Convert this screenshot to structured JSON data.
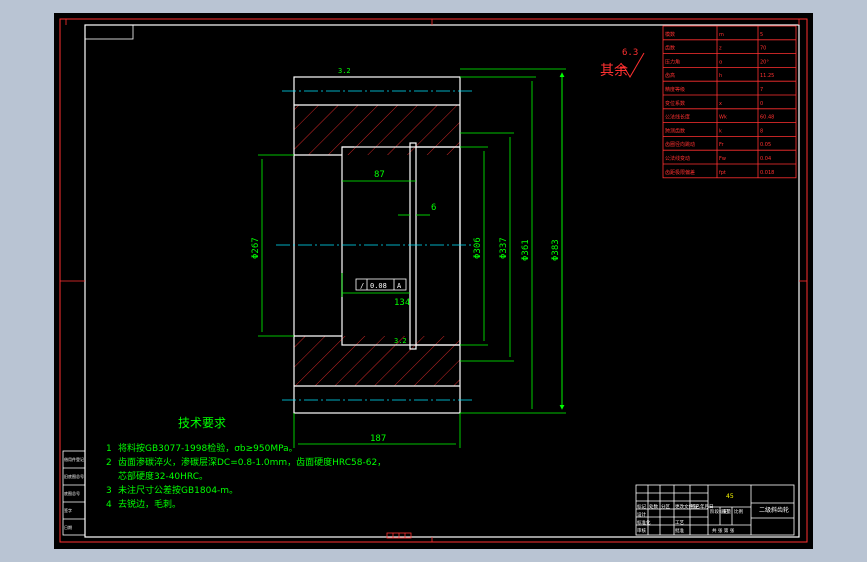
{
  "drawing": {
    "dimensions": {
      "d_large_outer": "Φ383",
      "d_outer": "Φ361",
      "d_mid": "Φ337",
      "d_inner_right": "Φ306",
      "d_bore": "Φ267",
      "len_87": "87",
      "len_134": "134",
      "len_187": "187",
      "groove_6": "6"
    },
    "roughness": {
      "top_edge": "3.2",
      "bottom_edge": "3.2",
      "rest_symbol_value": "6.3",
      "rest_label": "其余"
    },
    "tolerance_frame": {
      "symbol": "/",
      "value": "0.08",
      "datum": "A"
    },
    "tech_requirements": {
      "title": "技术要求",
      "items": [
        {
          "num": "1",
          "text": "将料按GB3077-1998检验，σb≥950MPa。"
        },
        {
          "num": "2",
          "text": "齿面渗碳淬火，渗碳层深DC=0.8-1.0mm，齿面硬度HRC58-62，"
        },
        {
          "num": "",
          "text": "芯部硬度32-40HRC。"
        },
        {
          "num": "3",
          "text": "未注尺寸公差按GB1804-m。"
        },
        {
          "num": "4",
          "text": "去锐边，毛刺。"
        }
      ]
    },
    "gear_table": [
      {
        "name": "模数",
        "sym": "m",
        "val": "5"
      },
      {
        "name": "齿数",
        "sym": "z",
        "val": "70"
      },
      {
        "name": "压力角",
        "sym": "α",
        "val": "20°"
      },
      {
        "name": "齿高",
        "sym": "h",
        "val": "11.25"
      },
      {
        "name": "精度等级",
        "sym": "",
        "val": "7"
      },
      {
        "name": "变位系数",
        "sym": "x",
        "val": "0"
      },
      {
        "name": "公法线长度",
        "sym": "Wk",
        "val": "60.48"
      },
      {
        "name": "跨测齿数",
        "sym": "k",
        "val": "8"
      },
      {
        "name": "齿圈径向跳动",
        "sym": "Fr",
        "val": "0.05"
      },
      {
        "name": "公法线变动",
        "sym": "Fw",
        "val": "0.04"
      },
      {
        "name": "齿距极限偏差",
        "sym": "fpt",
        "val": "0.018"
      }
    ],
    "title_block": {
      "material": "45",
      "part_name": "二级斜齿轮",
      "header_cells": [
        "标记",
        "处数",
        "分区",
        "更改文件号",
        "签名",
        "年月日"
      ],
      "role_cells": [
        "设计",
        "标准化",
        "审核",
        "工艺",
        "批准"
      ],
      "stage_label": "阶段标记",
      "weight_label": "重量",
      "scale_label": "比例",
      "sheet_label": "共 张 第 张"
    },
    "left_margin_labels": [
      "借用件登记",
      "旧底图总号",
      "底图总号",
      "签字",
      "日期"
    ]
  },
  "colors": {
    "background": "#000000",
    "frame": "#ffffff",
    "red": "#ff3030",
    "green": "#00ff00",
    "cyan": "#00e5ff"
  }
}
